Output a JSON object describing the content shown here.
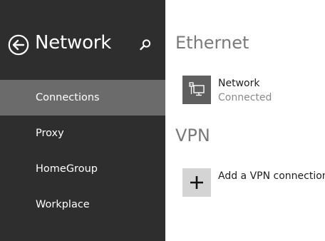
{
  "nav": {
    "title": "Network",
    "back_icon": "back-arrow-circle-icon",
    "search_icon": "search-icon",
    "items": [
      {
        "label": "Connections",
        "selected": true
      },
      {
        "label": "Proxy",
        "selected": false
      },
      {
        "label": "HomeGroup",
        "selected": false
      },
      {
        "label": "Workplace",
        "selected": false
      }
    ]
  },
  "content": {
    "ethernet": {
      "header": "Ethernet",
      "connection": {
        "icon": "ethernet-monitor-icon",
        "name": "Network",
        "status": "Connected"
      }
    },
    "vpn": {
      "header": "VPN",
      "add": {
        "icon": "plus-icon",
        "label": "Add a VPN connection"
      }
    }
  },
  "colors": {
    "nav_background": "#2e2e2e",
    "nav_selected": "#6b6b6b",
    "header_text": "#7a7a7a",
    "tile_dark": "#5f5f5f",
    "tile_light": "#d4d4d4"
  }
}
